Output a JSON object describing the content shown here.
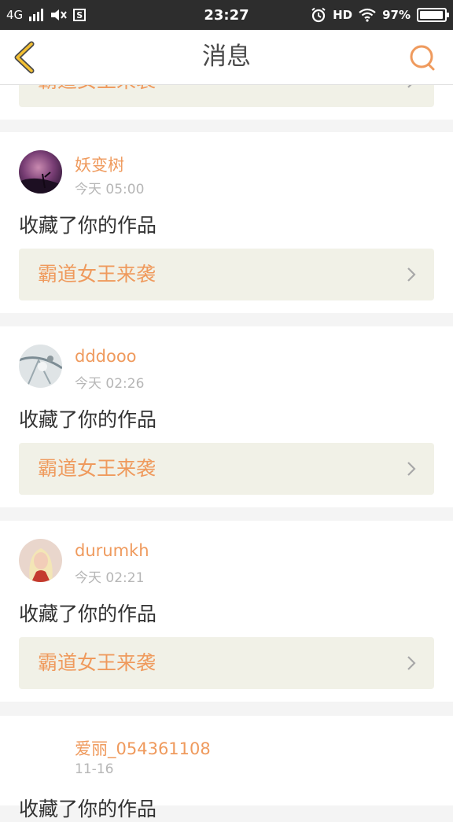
{
  "status_bar": {
    "network": "4G",
    "time": "23:27",
    "hd": "HD",
    "battery_pct": "97%",
    "battery_level": 0.97,
    "sim_letter": "S"
  },
  "nav": {
    "title": "消息"
  },
  "colors": {
    "accent": "#ef9a5d",
    "nav_back": "#f3c033",
    "card_work_bg": "#f1f1e7",
    "status_bar_bg": "#2d2d2d"
  },
  "messages": [
    {
      "work_title": "霸道女王来袭"
    },
    {
      "username": "妖变树",
      "time": "今天 05:00",
      "action": "收藏了你的作品",
      "work_title": "霸道女王来袭"
    },
    {
      "username": "dddooo",
      "time": "今天 02:26",
      "action": "收藏了你的作品",
      "work_title": "霸道女王来袭"
    },
    {
      "username": "durumkh",
      "time": "今天 02:21",
      "action": "收藏了你的作品",
      "work_title": "霸道女王来袭"
    },
    {
      "username": "爱丽_054361108",
      "time": "11-16",
      "action": "收藏了你的作品"
    }
  ]
}
